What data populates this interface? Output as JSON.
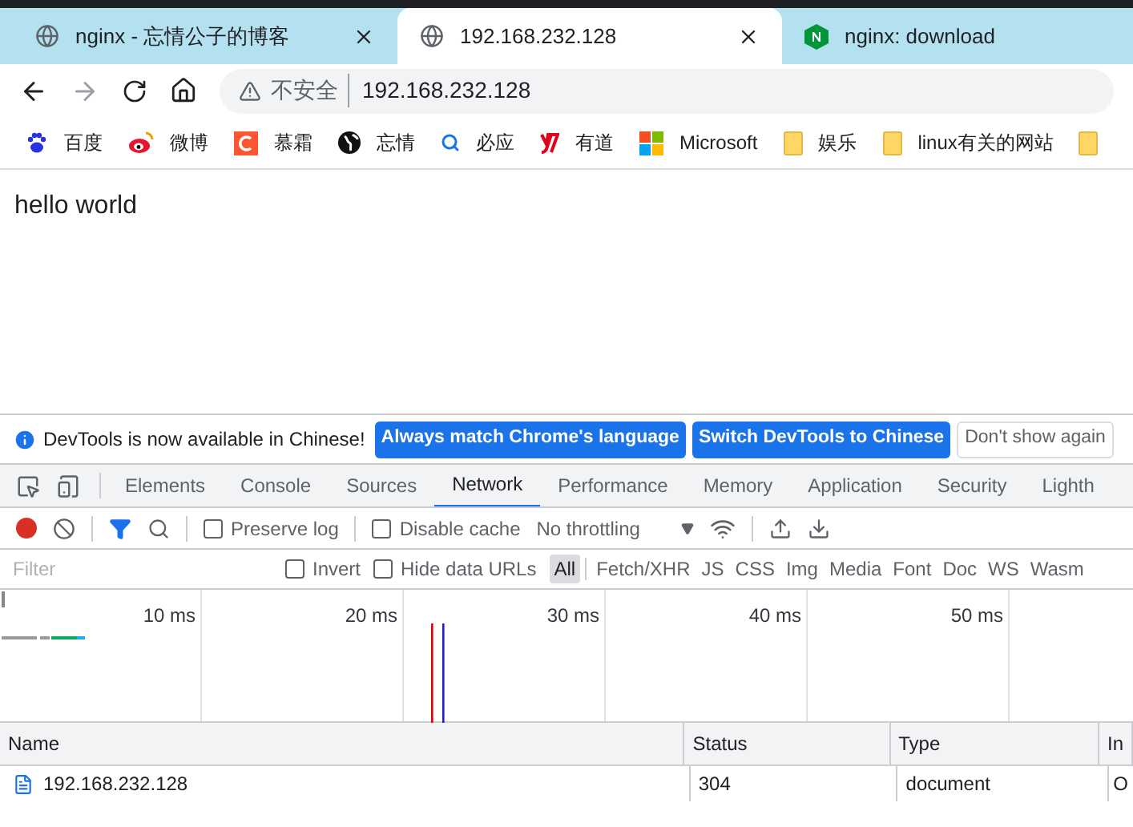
{
  "browser_tabs": [
    {
      "title": "nginx - 忘情公子的博客",
      "kind": "globe",
      "selected": false,
      "closable": true
    },
    {
      "title": "192.168.232.128",
      "kind": "globe",
      "selected": true,
      "closable": true
    },
    {
      "title": "nginx: download",
      "kind": "nginx",
      "selected": false,
      "closable": false
    }
  ],
  "address_bar": {
    "security": "不安全",
    "url": "192.168.232.128"
  },
  "bookmarks": [
    {
      "label": "百度",
      "kind": "baidu"
    },
    {
      "label": "微博",
      "kind": "weibo"
    },
    {
      "label": "慕霜",
      "kind": "c"
    },
    {
      "label": "忘情",
      "kind": "globe"
    },
    {
      "label": "必应",
      "kind": "search"
    },
    {
      "label": "有道",
      "kind": "youdao"
    },
    {
      "label": "Microsoft",
      "kind": "ms"
    },
    {
      "label": "娱乐",
      "kind": "folder"
    },
    {
      "label": "linux有关的网站",
      "kind": "folder"
    },
    {
      "kind": "folder"
    }
  ],
  "page": {
    "text": "hello world"
  },
  "infobar": {
    "message": "DevTools is now available in Chinese!",
    "buttons": [
      {
        "label": "Always match Chrome's language",
        "kind": "primary"
      },
      {
        "label": "Switch DevTools to Chinese",
        "kind": "primary"
      },
      {
        "label": "Don't show again",
        "kind": "secondary"
      }
    ]
  },
  "devtools_tabs": [
    {
      "label": "Elements",
      "selected": false
    },
    {
      "label": "Console",
      "selected": false
    },
    {
      "label": "Sources",
      "selected": false
    },
    {
      "label": "Network",
      "selected": true
    },
    {
      "label": "Performance",
      "selected": false
    },
    {
      "label": "Memory",
      "selected": false
    },
    {
      "label": "Application",
      "selected": false
    },
    {
      "label": "Security",
      "selected": false
    },
    {
      "label": "Lighth",
      "selected": false
    }
  ],
  "network_toolbar": {
    "recording": true,
    "preserve_log": {
      "label": "Preserve log",
      "checked": false
    },
    "disable_cache": {
      "label": "Disable cache",
      "checked": false
    },
    "throttling": "No throttling"
  },
  "filter_bar": {
    "placeholder": "Filter",
    "invert": {
      "label": "Invert",
      "checked": false
    },
    "hide_data_urls": {
      "label": "Hide data URLs",
      "checked": false
    },
    "types": [
      {
        "label": "All",
        "selected": true
      },
      {
        "label": "Fetch/XHR",
        "selected": false
      },
      {
        "label": "JS",
        "selected": false
      },
      {
        "label": "CSS",
        "selected": false
      },
      {
        "label": "Img",
        "selected": false
      },
      {
        "label": "Media",
        "selected": false
      },
      {
        "label": "Font",
        "selected": false
      },
      {
        "label": "Doc",
        "selected": false
      },
      {
        "label": "WS",
        "selected": false
      },
      {
        "label": "Wasm",
        "selected": false
      }
    ]
  },
  "timeline": {
    "ticks": [
      "10 ms",
      "20 ms",
      "30 ms",
      "40 ms",
      "50 ms"
    ]
  },
  "table": {
    "columns": [
      "Name",
      "Status",
      "Type",
      "In"
    ],
    "rows": [
      {
        "name": "192.168.232.128",
        "status": "304",
        "type": "document",
        "column_4": "O"
      }
    ]
  }
}
